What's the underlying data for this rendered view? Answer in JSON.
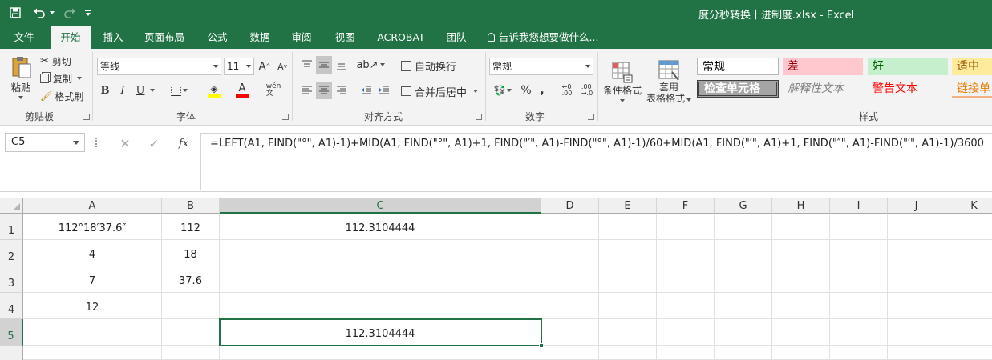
{
  "window": {
    "title": "度分秒转换十进制度.xlsx  -  Excel"
  },
  "qat": {
    "save_icon": "save-icon",
    "undo_icon": "undo-icon",
    "redo_icon": "redo-icon",
    "customize_icon": "customize-icon"
  },
  "tabs": [
    {
      "label": "文件",
      "active": false
    },
    {
      "label": "开始",
      "active": true
    },
    {
      "label": "插入",
      "active": false
    },
    {
      "label": "页面布局",
      "active": false
    },
    {
      "label": "公式",
      "active": false
    },
    {
      "label": "数据",
      "active": false
    },
    {
      "label": "审阅",
      "active": false
    },
    {
      "label": "视图",
      "active": false
    },
    {
      "label": "ACROBAT",
      "active": false
    },
    {
      "label": "团队",
      "active": false
    }
  ],
  "tell_me": "告诉我您想要做什么...",
  "clipboard": {
    "paste": "粘贴",
    "cut": "剪切",
    "copy": "复制",
    "format_painter": "格式刷",
    "group": "剪贴板"
  },
  "font": {
    "name": "等线",
    "size": "11",
    "group": "字体",
    "bold": "B",
    "italic": "I",
    "underline": "U"
  },
  "alignment": {
    "wrap": "自动换行",
    "merge": "合并后居中",
    "group": "对齐方式"
  },
  "number": {
    "format": "常规",
    "percent": "%",
    "comma": ",",
    "group": "数字"
  },
  "styles_group": {
    "conditional": "条件格式",
    "table_format_1": "套用",
    "table_format_2": "表格格式",
    "group": "样式",
    "cells": [
      {
        "label": "常规"
      },
      {
        "label": "差"
      },
      {
        "label": "好"
      },
      {
        "label": "适中"
      },
      {
        "label": "检查单元格"
      },
      {
        "label": "解释性文本"
      },
      {
        "label": "警告文本"
      },
      {
        "label": "链接单"
      }
    ]
  },
  "colors": {
    "accent": "#217346",
    "bad_bg": "#ffc7ce",
    "bad_fg": "#9c0006",
    "good_bg": "#c6efce",
    "good_fg": "#006100",
    "neutral_bg": "#ffeb9c",
    "neutral_fg": "#9c5700",
    "warning": "#ff0000",
    "link": "#e57c00"
  },
  "formula_bar": {
    "name_box": "C5",
    "cancel_icon": "cancel-icon",
    "enter_icon": "check-icon",
    "fx": "fx",
    "formula": "=LEFT(A1, FIND(\"°\", A1)-1)+MID(A1, FIND(\"°\", A1)+1, FIND(\"′\", A1)-FIND(\"°\", A1)-1)/60+MID(A1, FIND(\"′\", A1)+1, FIND(\"″\", A1)-FIND(\"′\", A1)-1)/3600"
  },
  "sheet": {
    "columns": [
      "A",
      "B",
      "C",
      "D",
      "E",
      "F",
      "G",
      "H",
      "I",
      "J",
      "K"
    ],
    "active_column": "C",
    "rows": [
      {
        "num": "1",
        "cells": {
          "A": "112°18′37.6″",
          "B": "112",
          "C": "112.3104444"
        }
      },
      {
        "num": "2",
        "cells": {
          "A": "4",
          "B": "18",
          "C": ""
        }
      },
      {
        "num": "3",
        "cells": {
          "A": "7",
          "B": "37.6",
          "C": ""
        }
      },
      {
        "num": "4",
        "cells": {
          "A": "12",
          "B": "",
          "C": ""
        }
      },
      {
        "num": "5",
        "cells": {
          "A": "",
          "B": "",
          "C": "112.3104444"
        }
      }
    ],
    "active_row": "5",
    "selected_cell": "C5"
  }
}
